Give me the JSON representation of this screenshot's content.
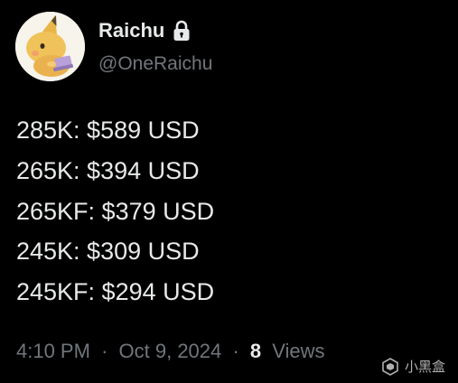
{
  "author": {
    "display_name": "Raichu",
    "handle": "@OneRaichu",
    "lock_icon": "lock-icon",
    "avatar_icon": "raichu-avatar"
  },
  "tweet": {
    "lines": [
      "285K: $589 USD",
      "265K: $394 USD",
      "265KF: $379 USD",
      "245K: $309 USD",
      "245KF: $294 USD"
    ]
  },
  "meta": {
    "time": "4:10 PM",
    "separator": "·",
    "date": "Oct 9, 2024",
    "views_count": "8",
    "views_label": "Views"
  },
  "watermark": {
    "text": "小黑盒",
    "icon": "xiaoheihe-logo-icon"
  },
  "colors": {
    "background": "#000000",
    "text_primary": "#e7e9ea",
    "text_secondary": "#71767b"
  }
}
